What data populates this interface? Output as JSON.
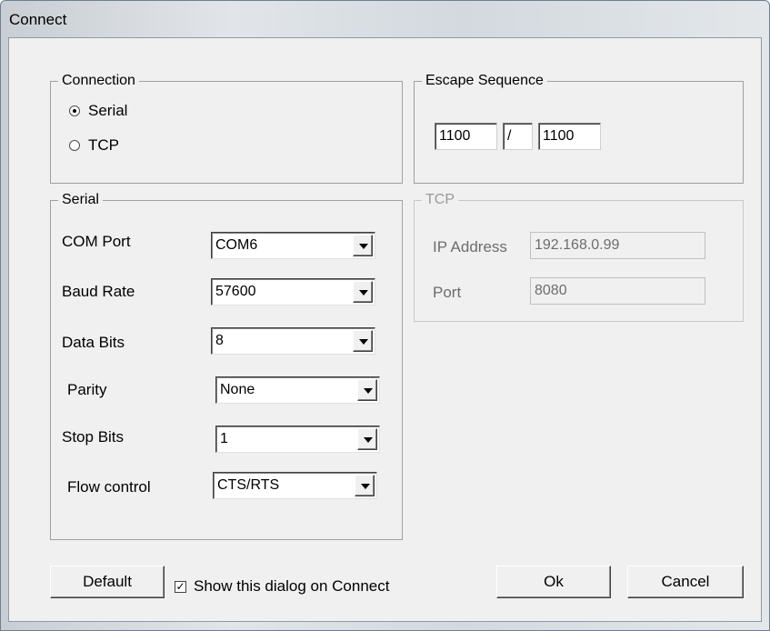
{
  "window": {
    "title": "Connect"
  },
  "connection": {
    "title": "Connection",
    "options": [
      {
        "label": "Serial",
        "selected": true
      },
      {
        "label": "TCP",
        "selected": false
      }
    ]
  },
  "escape": {
    "title": "Escape Sequence",
    "first": "1100",
    "separator": "/",
    "second": "1100"
  },
  "serial": {
    "title": "Serial",
    "fields": [
      {
        "label": "COM Port",
        "value": "COM6"
      },
      {
        "label": "Baud Rate",
        "value": "57600"
      },
      {
        "label": "Data Bits",
        "value": "8"
      },
      {
        "label": "Parity",
        "value": "None"
      },
      {
        "label": "Stop Bits",
        "value": "1"
      },
      {
        "label": "Flow control",
        "value": "CTS/RTS"
      }
    ]
  },
  "tcp": {
    "title": "TCP",
    "ip_label": "IP Address",
    "ip_value": "192.168.0.99",
    "port_label": "Port",
    "port_value": "8080",
    "enabled": false
  },
  "footer": {
    "default_label": "Default",
    "show_dialog_label": "Show this dialog on Connect",
    "show_dialog_checked": true,
    "ok_label": "Ok",
    "cancel_label": "Cancel"
  }
}
